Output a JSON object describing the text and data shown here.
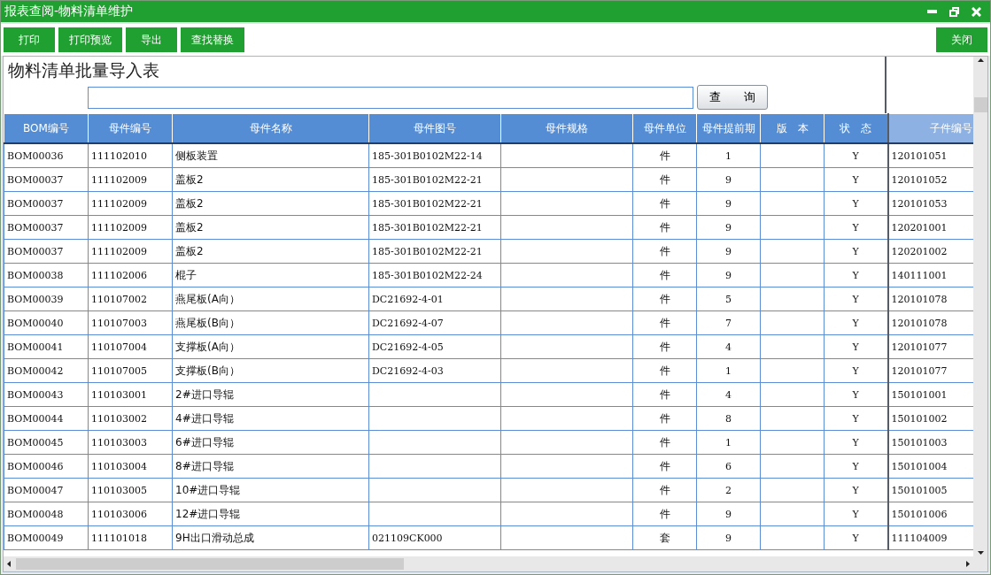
{
  "window": {
    "title": "报表查阅-物料清单维护"
  },
  "toolbar": {
    "buttons": [
      "打印",
      "打印预览",
      "导出",
      "查找替换"
    ],
    "close_button": "关闭"
  },
  "report": {
    "title": "物料清单批量导入表",
    "search": {
      "button": "查　　询"
    }
  },
  "table": {
    "columns": [
      "BOM编号",
      "母件编号",
      "母件名称",
      "母件图号",
      "母件规格",
      "母件单位",
      "母件提前期",
      "版　本",
      "状　态",
      "子件编号"
    ],
    "rows": [
      [
        "BOM00036",
        "111102010",
        "侧板装置",
        "185-301B0102M22-14",
        "",
        "件",
        "1",
        "",
        "Y",
        "120101051"
      ],
      [
        "BOM00037",
        "111102009",
        "盖板2",
        "185-301B0102M22-21",
        "",
        "件",
        "9",
        "",
        "Y",
        "120101052"
      ],
      [
        "BOM00037",
        "111102009",
        "盖板2",
        "185-301B0102M22-21",
        "",
        "件",
        "9",
        "",
        "Y",
        "120101053"
      ],
      [
        "BOM00037",
        "111102009",
        "盖板2",
        "185-301B0102M22-21",
        "",
        "件",
        "9",
        "",
        "Y",
        "120201001"
      ],
      [
        "BOM00037",
        "111102009",
        "盖板2",
        "185-301B0102M22-21",
        "",
        "件",
        "9",
        "",
        "Y",
        "120201002"
      ],
      [
        "BOM00038",
        "111102006",
        "棍子",
        "185-301B0102M22-24",
        "",
        "件",
        "9",
        "",
        "Y",
        "140111001"
      ],
      [
        "BOM00039",
        "110107002",
        "燕尾板(A向）",
        "DC21692-4-01",
        "",
        "件",
        "5",
        "",
        "Y",
        "120101078"
      ],
      [
        "BOM00040",
        "110107003",
        "燕尾板(B向）",
        "DC21692-4-07",
        "",
        "件",
        "7",
        "",
        "Y",
        "120101078"
      ],
      [
        "BOM00041",
        "110107004",
        "支撑板(A向）",
        "DC21692-4-05",
        "",
        "件",
        "4",
        "",
        "Y",
        "120101077"
      ],
      [
        "BOM00042",
        "110107005",
        "支撑板(B向）",
        "DC21692-4-03",
        "",
        "件",
        "1",
        "",
        "Y",
        "120101077"
      ],
      [
        "BOM00043",
        "110103001",
        "2#进口导辊",
        "",
        "",
        "件",
        "4",
        "",
        "Y",
        "150101001"
      ],
      [
        "BOM00044",
        "110103002",
        "4#进口导辊",
        "",
        "",
        "件",
        "8",
        "",
        "Y",
        "150101002"
      ],
      [
        "BOM00045",
        "110103003",
        "6#进口导辊",
        "",
        "",
        "件",
        "1",
        "",
        "Y",
        "150101003"
      ],
      [
        "BOM00046",
        "110103004",
        "8#进口导辊",
        "",
        "",
        "件",
        "6",
        "",
        "Y",
        "150101004"
      ],
      [
        "BOM00047",
        "110103005",
        "10#进口导辊",
        "",
        "",
        "件",
        "2",
        "",
        "Y",
        "150101005"
      ],
      [
        "BOM00048",
        "110103006",
        "12#进口导辊",
        "",
        "",
        "件",
        "9",
        "",
        "Y",
        "150101006"
      ],
      [
        "BOM00049",
        "111101018",
        "9H出口滑动总成",
        "021109CK000",
        "",
        "套",
        "9",
        "",
        "Y",
        "111104009"
      ]
    ]
  }
}
